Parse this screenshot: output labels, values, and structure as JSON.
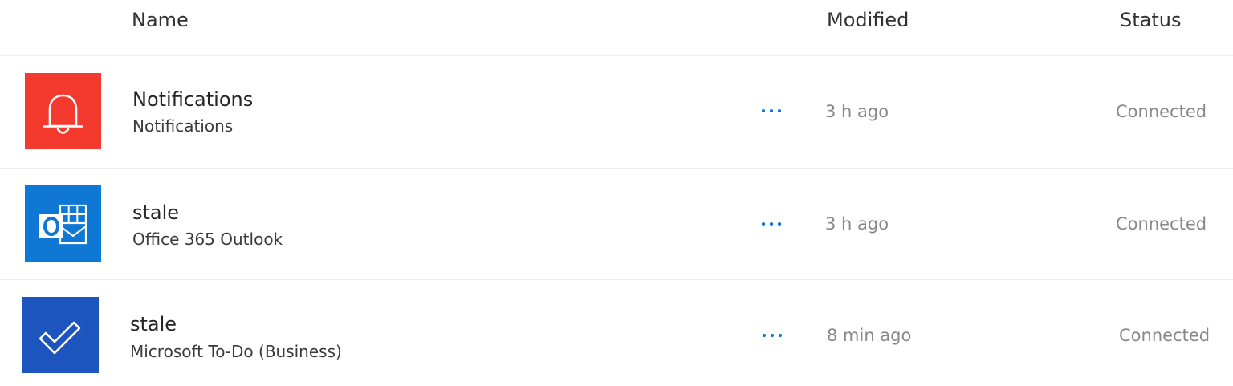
{
  "header": {
    "name_label": "Name",
    "modified_label": "Modified",
    "status_label": "Status"
  },
  "connections": [
    {
      "title": "Notifications",
      "subtitle": "Notifications",
      "modified": "3 h ago",
      "status": "Connected",
      "icon": "bell-icon",
      "icon_bg": "#f4392e"
    },
    {
      "title": "stale",
      "subtitle": "Office 365 Outlook",
      "modified": "3 h ago",
      "status": "Connected",
      "icon": "outlook-icon",
      "icon_bg": "#0f78d4"
    },
    {
      "title": "stale",
      "subtitle": "Microsoft To-Do (Business)",
      "modified": "8 min ago",
      "status": "Connected",
      "icon": "todo-check-icon",
      "icon_bg": "#1c55bd"
    }
  ],
  "colors": {
    "more_dots": "#0078d4",
    "muted_text": "#8a8886"
  }
}
